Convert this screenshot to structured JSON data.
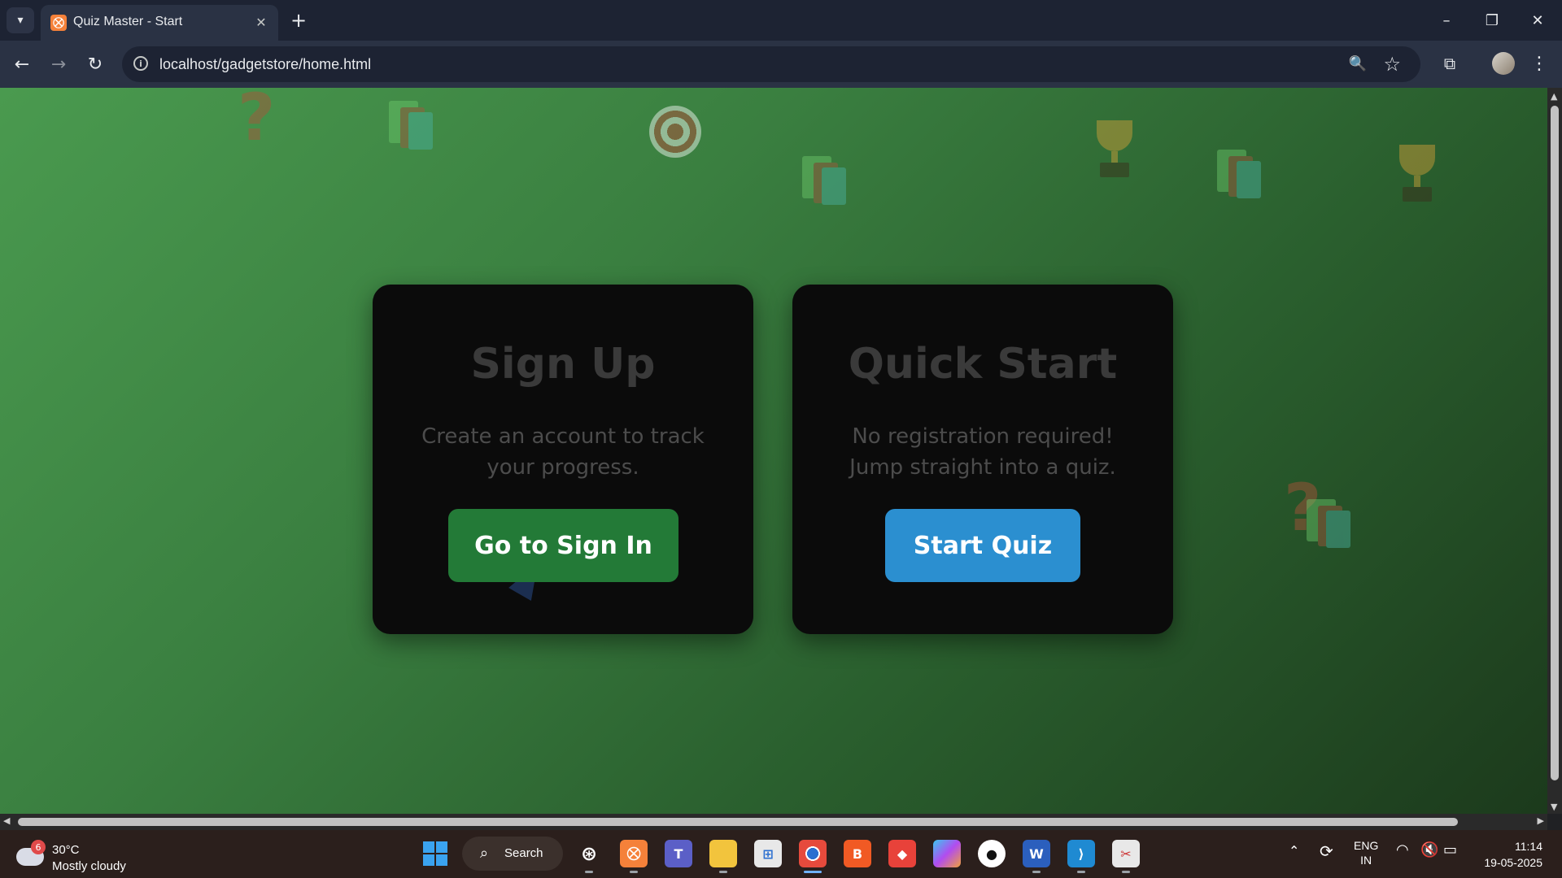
{
  "browser": {
    "tab_title": "Quiz Master - Start",
    "tab_favicon_glyph": "⛒",
    "url": "localhost/gadgetstore/home.html",
    "icons": {
      "tab_search": "chevron-down-icon",
      "close": "close-icon",
      "new_tab": "plus-icon",
      "back": "back-arrow-icon",
      "forward": "forward-arrow-icon",
      "reload": "reload-icon",
      "site_info": "info-icon",
      "zoom": "zoom-icon",
      "bookmark": "star-icon",
      "extensions": "puzzle-icon",
      "menu": "kebab-menu-icon"
    }
  },
  "page": {
    "cards": [
      {
        "title": "Sign Up",
        "description": "Create an account to track your progress.",
        "button_label": "Go to Sign In",
        "button_color": "#237a37"
      },
      {
        "title": "Quick Start",
        "description": "No registration required! Jump straight into a quiz.",
        "button_label": "Start Quiz",
        "button_color": "#2b8fd0"
      }
    ],
    "background_gradient": [
      "#4a9a4f",
      "#1c3a1c"
    ],
    "decorations": [
      "question-mark-icon",
      "books-icon",
      "target-icon",
      "trophy-icon",
      "party-popper-icon"
    ]
  },
  "taskbar": {
    "weather": {
      "badge": "6",
      "temperature": "30°C",
      "condition": "Mostly cloudy"
    },
    "search_label": "Search",
    "apps": [
      "windows-start-icon",
      "chatgpt-icon",
      "xampp-icon",
      "teams-icon",
      "file-explorer-icon",
      "microsoft-store-icon",
      "chrome-icon",
      "brave-icon",
      "anydesk-icon",
      "copilot-icon",
      "github-icon",
      "word-icon",
      "vscode-icon",
      "snipping-tool-icon"
    ],
    "tray": {
      "lang_line1": "ENG",
      "lang_line2": "IN",
      "time": "11:14",
      "date": "19-05-2025"
    }
  }
}
